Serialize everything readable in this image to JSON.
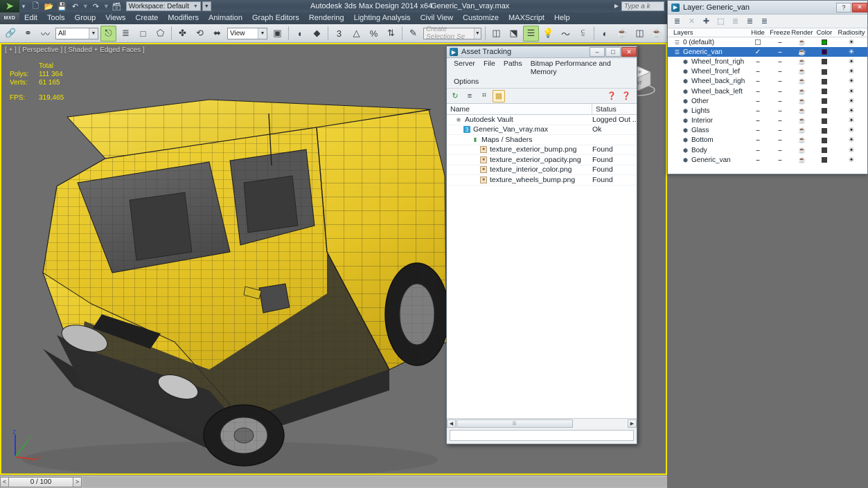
{
  "titlebar": {
    "app_logo": "max-logo-icon",
    "quick_access": [
      {
        "name": "new-file-button",
        "glyph": "⬜"
      },
      {
        "name": "open-file-button",
        "glyph": "📂"
      },
      {
        "name": "save-file-button",
        "glyph": "💾"
      },
      {
        "name": "undo-button",
        "glyph": "↶"
      },
      {
        "name": "redo-button",
        "glyph": "↷"
      },
      {
        "name": "set-project-folder-button",
        "glyph": "🗂"
      }
    ],
    "workspace_label": "Workspace: Default",
    "app_title": "Autodesk 3ds Max Design 2014 x64",
    "file_title": "Generic_Van_vray.max",
    "search_placeholder": "Type a k"
  },
  "menubar": {
    "badge": "MXD",
    "items": [
      "Edit",
      "Tools",
      "Group",
      "Views",
      "Create",
      "Modifiers",
      "Animation",
      "Graph Editors",
      "Rendering",
      "Lighting Analysis",
      "Civil View",
      "Customize",
      "MAXScript",
      "Help"
    ]
  },
  "toolbar": {
    "selection_filter": "All",
    "reference_coord": "View",
    "named_selection_sets": "Create Selection Se",
    "snap_value": "3",
    "percent_label": "%",
    "buttons": [
      {
        "name": "select-and-link-icon",
        "glyph": "🔗"
      },
      {
        "name": "unlink-selection-icon",
        "glyph": "✂"
      },
      {
        "name": "bind-to-space-warp-icon",
        "glyph": "〰"
      },
      {
        "name": "select-object-icon",
        "glyph": "⬚"
      },
      {
        "name": "select-by-name-icon",
        "glyph": "≣"
      },
      {
        "name": "rectangular-selection-region-icon",
        "glyph": "▢"
      },
      {
        "name": "window-crossing-icon",
        "glyph": "⬡"
      },
      {
        "name": "select-and-move-icon",
        "glyph": "✤"
      },
      {
        "name": "select-and-rotate-icon",
        "glyph": "↻"
      },
      {
        "name": "select-and-scale-icon",
        "glyph": "⬌"
      },
      {
        "name": "use-center-flyout-icon",
        "glyph": "▣"
      },
      {
        "name": "snaps-toggle-icon",
        "glyph": "3"
      },
      {
        "name": "angle-snap-toggle-icon",
        "glyph": "◿"
      },
      {
        "name": "percent-snap-toggle-icon",
        "glyph": "%"
      },
      {
        "name": "spinner-snap-toggle-icon",
        "glyph": "↕"
      },
      {
        "name": "edit-named-selection-sets-icon",
        "glyph": "✎"
      },
      {
        "name": "mirror-icon",
        "glyph": "◫"
      },
      {
        "name": "align-icon",
        "glyph": "⬒"
      },
      {
        "name": "layer-manager-icon",
        "glyph": "☰"
      },
      {
        "name": "toggle-scene-explorer-icon",
        "glyph": "💡"
      },
      {
        "name": "curve-editor-icon",
        "glyph": "〜"
      },
      {
        "name": "schematic-view-icon",
        "glyph": "⧉"
      },
      {
        "name": "material-editor-icon",
        "glyph": "◐"
      },
      {
        "name": "render-setup-icon",
        "glyph": "🫖"
      },
      {
        "name": "rendered-frame-window-icon",
        "glyph": "⬜"
      },
      {
        "name": "render-production-icon",
        "glyph": "🫖"
      }
    ]
  },
  "viewport": {
    "label": "[ + ] [ Perspective ] [ Shaded + Edged Faces ]",
    "stats": {
      "total_header": "Total",
      "polys_label": "Polys:",
      "polys_value": "111 364",
      "verts_label": "Verts:",
      "verts_value": "61 165",
      "fps_label": "FPS:",
      "fps_value": "319,465"
    },
    "axis": {
      "x": "X",
      "y": "Y",
      "z": "Z"
    },
    "viewcube": {
      "front": "FRONT",
      "top": "TOP"
    },
    "border_color": "#f2e500",
    "background_color": "#6e6e6e",
    "model_color": "#e8c72a"
  },
  "timeline": {
    "prev_label": "<",
    "frame_label": "0 / 100",
    "next_label": ">"
  },
  "asset_tracking": {
    "title": "Asset Tracking",
    "menu_row1": [
      "Server",
      "File",
      "Paths",
      "Bitmap Performance and Memory"
    ],
    "menu_row2": [
      "Options"
    ],
    "window_buttons": [
      {
        "name": "minimize-button",
        "glyph": "–"
      },
      {
        "name": "maximize-button",
        "glyph": "□"
      },
      {
        "name": "close-button",
        "glyph": "✕"
      }
    ],
    "toolbar_buttons": [
      {
        "name": "refresh-icon",
        "glyph": "↻",
        "selected": false
      },
      {
        "name": "list-view-icon",
        "glyph": "≡",
        "selected": false
      },
      {
        "name": "thumbnail-view-icon",
        "glyph": "⌗",
        "selected": false
      },
      {
        "name": "grid-view-icon",
        "glyph": "▦",
        "selected": true
      }
    ],
    "help_buttons": [
      {
        "name": "vault-help-icon",
        "glyph": "❓"
      },
      {
        "name": "help-icon",
        "glyph": "❓"
      }
    ],
    "columns": {
      "name": "Name",
      "status": "Status"
    },
    "rows": [
      {
        "indent": 1,
        "icon": "vault-icon",
        "name": "Autodesk Vault",
        "status": "Logged Out ..."
      },
      {
        "indent": 2,
        "icon": "max-file-icon",
        "name": "Generic_Van_vray.max",
        "status": "Ok"
      },
      {
        "indent": 3,
        "icon": "maps-shaders-icon",
        "name": "Maps / Shaders",
        "status": ""
      },
      {
        "indent": 4,
        "icon": "bitmap-icon",
        "name": "texture_exterior_bump.png",
        "status": "Found"
      },
      {
        "indent": 4,
        "icon": "bitmap-icon",
        "name": "texture_exterior_opacity.png",
        "status": "Found"
      },
      {
        "indent": 4,
        "icon": "bitmap-icon",
        "name": "texture_interior_color.png",
        "status": "Found"
      },
      {
        "indent": 4,
        "icon": "bitmap-icon",
        "name": "texture_wheels_bump.png",
        "status": "Found"
      }
    ],
    "status_text": ""
  },
  "layer_panel": {
    "title": "Layer: Generic_van",
    "window_buttons": [
      {
        "name": "help-button",
        "glyph": "?"
      },
      {
        "name": "close-button",
        "glyph": "✕"
      }
    ],
    "toolbar_buttons": [
      {
        "name": "create-new-layer-icon",
        "glyph": "≣",
        "dim": false
      },
      {
        "name": "delete-layer-icon",
        "glyph": "✕",
        "dim": true
      },
      {
        "name": "add-selection-to-layer-icon",
        "glyph": "✚",
        "dim": false
      },
      {
        "name": "select-objects-in-layer-icon",
        "glyph": "⬚",
        "dim": false
      },
      {
        "name": "set-current-layer-icon",
        "glyph": "≣",
        "dim": true
      },
      {
        "name": "layer-properties-icon",
        "glyph": "≣",
        "dim": false
      },
      {
        "name": "hide-unhide-layer-icon",
        "glyph": "≣",
        "dim": false
      }
    ],
    "columns": [
      "Layers",
      "Hide",
      "Freeze",
      "Render",
      "Color",
      "Radiosity"
    ],
    "rows": [
      {
        "name": "0 (default)",
        "indent": 0,
        "icon": "layer-icon",
        "selected": false,
        "current": false,
        "hide": "checkbox",
        "freeze": "–",
        "render_dash": "–",
        "color": "#00a000",
        "radiosity": "radiosity-icon"
      },
      {
        "name": "Generic_van",
        "indent": 0,
        "icon": "layer-icon",
        "selected": true,
        "current": true,
        "hide": "–",
        "freeze": "–",
        "render_dash": "–",
        "color": "#2a0066",
        "radiosity": "radiosity-icon"
      },
      {
        "name": "Wheel_front_righ",
        "indent": 1,
        "icon": "object-icon",
        "selected": false,
        "current": false,
        "hide": "–",
        "freeze": "–",
        "render_dash": "–",
        "color": "#3f3f3f",
        "radiosity": "radiosity-icon"
      },
      {
        "name": "Wheel_front_lef",
        "indent": 1,
        "icon": "object-icon",
        "selected": false,
        "current": false,
        "hide": "–",
        "freeze": "–",
        "render_dash": "–",
        "color": "#3f3f3f",
        "radiosity": "radiosity-icon"
      },
      {
        "name": "Wheel_back_righ",
        "indent": 1,
        "icon": "object-icon",
        "selected": false,
        "current": false,
        "hide": "–",
        "freeze": "–",
        "render_dash": "–",
        "color": "#3f3f3f",
        "radiosity": "radiosity-icon"
      },
      {
        "name": "Wheel_back_left",
        "indent": 1,
        "icon": "object-icon",
        "selected": false,
        "current": false,
        "hide": "–",
        "freeze": "–",
        "render_dash": "–",
        "color": "#3f3f3f",
        "radiosity": "radiosity-icon"
      },
      {
        "name": "Other",
        "indent": 1,
        "icon": "object-icon",
        "selected": false,
        "current": false,
        "hide": "–",
        "freeze": "–",
        "render_dash": "–",
        "color": "#3f3f3f",
        "radiosity": "radiosity-icon"
      },
      {
        "name": "Lights",
        "indent": 1,
        "icon": "object-icon",
        "selected": false,
        "current": false,
        "hide": "–",
        "freeze": "–",
        "render_dash": "–",
        "color": "#3f3f3f",
        "radiosity": "radiosity-icon"
      },
      {
        "name": "Interior",
        "indent": 1,
        "icon": "object-icon",
        "selected": false,
        "current": false,
        "hide": "–",
        "freeze": "–",
        "render_dash": "–",
        "color": "#3f3f3f",
        "radiosity": "radiosity-icon"
      },
      {
        "name": "Glass",
        "indent": 1,
        "icon": "object-icon",
        "selected": false,
        "current": false,
        "hide": "–",
        "freeze": "–",
        "render_dash": "–",
        "color": "#3f3f3f",
        "radiosity": "radiosity-icon"
      },
      {
        "name": "Bottom",
        "indent": 1,
        "icon": "object-icon",
        "selected": false,
        "current": false,
        "hide": "–",
        "freeze": "–",
        "render_dash": "–",
        "color": "#3f3f3f",
        "radiosity": "radiosity-icon"
      },
      {
        "name": "Body",
        "indent": 1,
        "icon": "object-icon",
        "selected": false,
        "current": false,
        "hide": "–",
        "freeze": "–",
        "render_dash": "–",
        "color": "#3f3f3f",
        "radiosity": "radiosity-icon"
      },
      {
        "name": "Generic_van",
        "indent": 1,
        "icon": "object-icon",
        "selected": false,
        "current": false,
        "hide": "–",
        "freeze": "–",
        "render_dash": "–",
        "color": "#3f3f3f",
        "radiosity": "radiosity-icon"
      }
    ]
  }
}
